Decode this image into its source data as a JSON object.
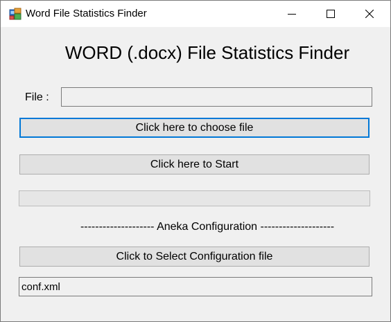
{
  "window": {
    "title": "Word File Statistics Finder",
    "icon": "app-icon",
    "controls": [
      "minimize-icon",
      "maximize-icon",
      "close-icon"
    ]
  },
  "main": {
    "heading": "WORD (.docx) File Statistics Finder",
    "file_label": "File :",
    "file_value": "",
    "choose_button": "Click here to choose file",
    "start_button": "Click here to Start",
    "progress": 0,
    "separator": "-------------------- Aneka Configuration --------------------",
    "config_button": "Click to Select Configuration file",
    "config_value": "conf.xml"
  },
  "colors": {
    "window_bg": "#f0f0f0",
    "button_bg": "#e1e1e1",
    "focus_border": "#0078d7"
  }
}
